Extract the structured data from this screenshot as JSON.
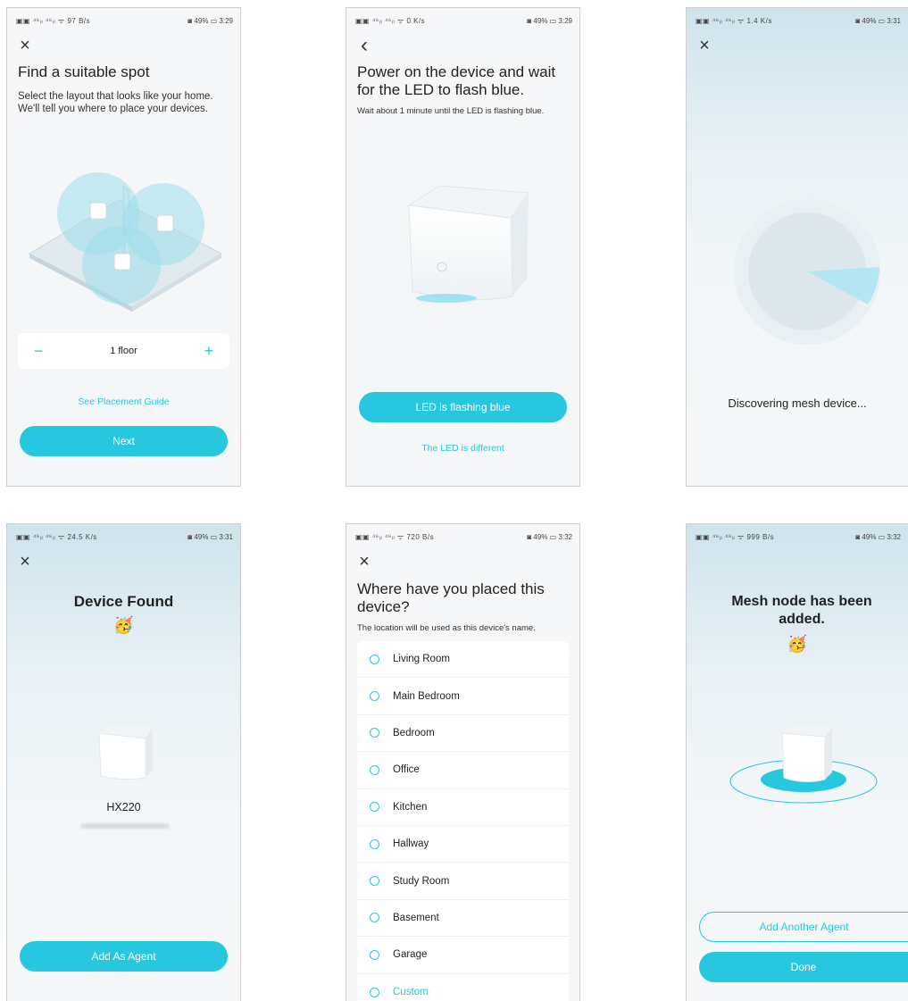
{
  "accent_color": "#28c7e0",
  "screens": {
    "s1": {
      "status_left": "▣▣ ⁴⁶ᵢₗ ⁴⁶ᵢₗ ᯤ 97 B/s",
      "status_right": "◙ 49% ▭ 3:29",
      "title": "Find a suitable spot",
      "subtitle": "Select the layout that looks like your home. We'll tell you where to place your devices.",
      "stepper_minus": "−",
      "stepper_value": "1 floor",
      "stepper_plus": "+",
      "link": "See Placement Guide",
      "button": "Next"
    },
    "s2": {
      "status_left": "▣▣ ⁴⁶ᵢₗ ⁴⁶ᵢₗ ᯤ 0 K/s",
      "status_right": "◙ 49% ▭ 3:29",
      "title": "Power on the device and wait for the LED to flash blue.",
      "subtitle": "Wait about 1 minute until the LED is flashing blue.",
      "button": "LED is flashing blue",
      "link": "The LED is different"
    },
    "s3": {
      "status_left": "▣▣ ⁴⁶ᵢₗ ⁴⁶ᵢₗ ᯤ 1.4 K/s",
      "status_right": "◙ 49% ▭ 3:31",
      "message": "Discovering mesh device..."
    },
    "s4": {
      "status_left": "▣▣ ⁴⁶ᵢₗ ⁴⁶ᵢₗ ᯤ 24.5 K/s",
      "status_right": "◙ 49% ▭ 3:31",
      "title": "Device Found",
      "emoji": "🥳",
      "device_name": "HX220",
      "button": "Add As Agent"
    },
    "s5": {
      "status_left": "▣▣ ⁴⁶ᵢₗ ⁴⁶ᵢₗ ᯤ 720 B/s",
      "status_right": "◙ 49% ▭ 3:32",
      "title": "Where have you placed this device?",
      "subtitle": "The location will be used as this device's name.",
      "options": [
        "Living Room",
        "Main Bedroom",
        "Bedroom",
        "Office",
        "Kitchen",
        "Hallway",
        "Study Room",
        "Basement",
        "Garage",
        "Custom"
      ]
    },
    "s6": {
      "status_left": "▣▣ ⁴⁶ᵢₗ ⁴⁶ᵢₗ ᯤ 999 B/s",
      "status_right": "◙ 49% ▭ 3:32",
      "title": "Mesh node has been added.",
      "emoji": "🥳",
      "button_outline": "Add Another Agent",
      "button": "Done"
    }
  },
  "icons": {
    "close": "×",
    "back": "‹"
  }
}
